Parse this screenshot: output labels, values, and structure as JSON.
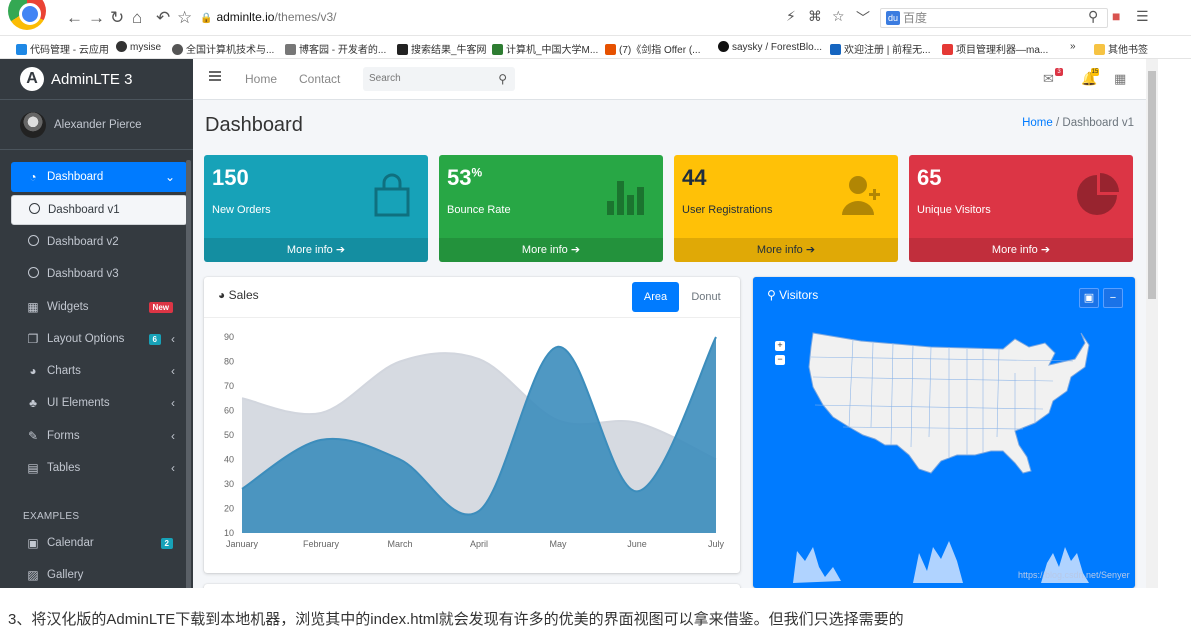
{
  "browser": {
    "url_host": "adminlte.io",
    "url_path": "/themes/v3/",
    "search_text": "百度",
    "bookmarks": [
      "代码管理 - 云应用",
      "mysise",
      "全国计算机技术与...",
      "博客园 - 开发者的...",
      "搜索结果_牛客网",
      "计算机_中国大学M...",
      "(7)《剑指 Offer (...",
      "saysky / ForestBlo...",
      "欢迎注册 | 前程无...",
      "项目管理利器—ma...",
      "»",
      "其他书签"
    ]
  },
  "sidebar": {
    "brand": "AdminLTE 3",
    "user": "Alexander Pierce",
    "items": [
      {
        "label": "Dashboard",
        "icon": "tachometer-icon"
      },
      {
        "label": "Dashboard v1",
        "icon": "circle-icon"
      },
      {
        "label": "Dashboard v2",
        "icon": "circle-icon"
      },
      {
        "label": "Dashboard v3",
        "icon": "circle-icon"
      },
      {
        "label": "Widgets",
        "icon": "grid-icon",
        "badge": "New"
      },
      {
        "label": "Layout Options",
        "icon": "copy-icon",
        "badge": "6"
      },
      {
        "label": "Charts",
        "icon": "pie-icon"
      },
      {
        "label": "UI Elements",
        "icon": "tree-icon"
      },
      {
        "label": "Forms",
        "icon": "edit-icon"
      },
      {
        "label": "Tables",
        "icon": "table-icon"
      },
      {
        "label": "Calendar",
        "icon": "calendar-icon",
        "badge": "2"
      },
      {
        "label": "Gallery",
        "icon": "image-icon"
      }
    ],
    "examples_header": "EXAMPLES"
  },
  "topnav": {
    "home": "Home",
    "contact": "Contact",
    "search_placeholder": "Search",
    "msg_badge": "3",
    "notif_badge": "15"
  },
  "page": {
    "title": "Dashboard",
    "breadcrumb_home": "Home",
    "breadcrumb_sep": "/",
    "breadcrumb_current": "Dashboard v1"
  },
  "stats": [
    {
      "value": "150",
      "sup": "",
      "label": "New Orders",
      "more": "More info",
      "color": "#17a2b8"
    },
    {
      "value": "53",
      "sup": "%",
      "label": "Bounce Rate",
      "more": "More info",
      "color": "#28a745"
    },
    {
      "value": "44",
      "sup": "",
      "label": "User Registrations",
      "more": "More info",
      "color": "#ffc107"
    },
    {
      "value": "65",
      "sup": "",
      "label": "Unique Visitors",
      "more": "More info",
      "color": "#dc3545"
    }
  ],
  "sales": {
    "title": "Sales",
    "tab_area": "Area",
    "tab_donut": "Donut"
  },
  "visitors": {
    "title": "Visitors"
  },
  "chart_data": {
    "type": "area",
    "categories": [
      "January",
      "February",
      "March",
      "April",
      "May",
      "June",
      "July"
    ],
    "yticks": [
      10,
      20,
      30,
      40,
      50,
      60,
      70,
      80,
      90
    ],
    "ylim": [
      10,
      90
    ],
    "series": [
      {
        "values": [
          65,
          59,
          80,
          81,
          56,
          55,
          40
        ],
        "color": "#d2d6de"
      },
      {
        "values": [
          28,
          48,
          40,
          19,
          86,
          27,
          90
        ],
        "color": "#3c8dbc"
      }
    ]
  },
  "watermark": "https://blog.csdn.net/Senyer",
  "caption": "3、将汉化版的AdminLTE下载到本地机器，浏览其中的index.html就会发现有许多的优美的界面视图可以拿来借鉴。但我们只选择需要的"
}
